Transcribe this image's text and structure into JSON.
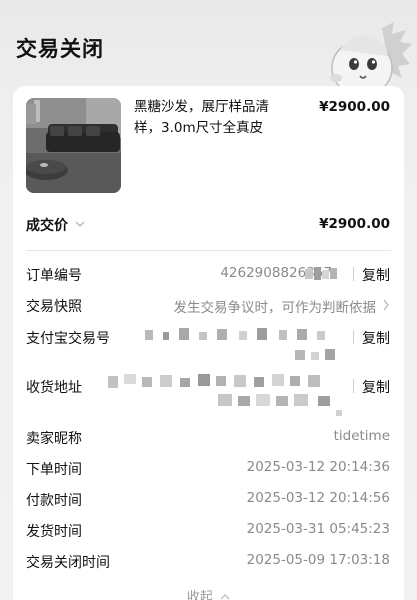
{
  "header": {
    "title": "交易关闭"
  },
  "product": {
    "title": "黑糖沙发，展厅样品清样，3.0m尺寸全真皮",
    "price": "¥2900.00"
  },
  "deal": {
    "label": "成交价",
    "price": "¥2900.00"
  },
  "details": {
    "order_no_label": "订单编号",
    "order_no_value": "4262908826357",
    "snapshot_label": "交易快照",
    "snapshot_value": "发生交易争议时，可作为判断依据",
    "alipay_label": "支付宝交易号",
    "address_label": "收货地址",
    "seller_label": "卖家昵称",
    "seller_value": "tidetime",
    "order_time_label": "下单时间",
    "order_time_value": "2025-03-12 20:14:36",
    "pay_time_label": "付款时间",
    "pay_time_value": "2025-03-12 20:14:56",
    "ship_time_label": "发货时间",
    "ship_time_value": "2025-03-31 05:45:23",
    "close_time_label": "交易关闭时间",
    "close_time_value": "2025-05-09 17:03:18",
    "copy_label": "复制",
    "collapse_label": "收起"
  },
  "icons": {
    "mascot": "mascot-icon",
    "deal_expand": "chevron-down-icon",
    "snapshot": "chevron-right-icon",
    "collapse": "chevron-up-icon"
  }
}
